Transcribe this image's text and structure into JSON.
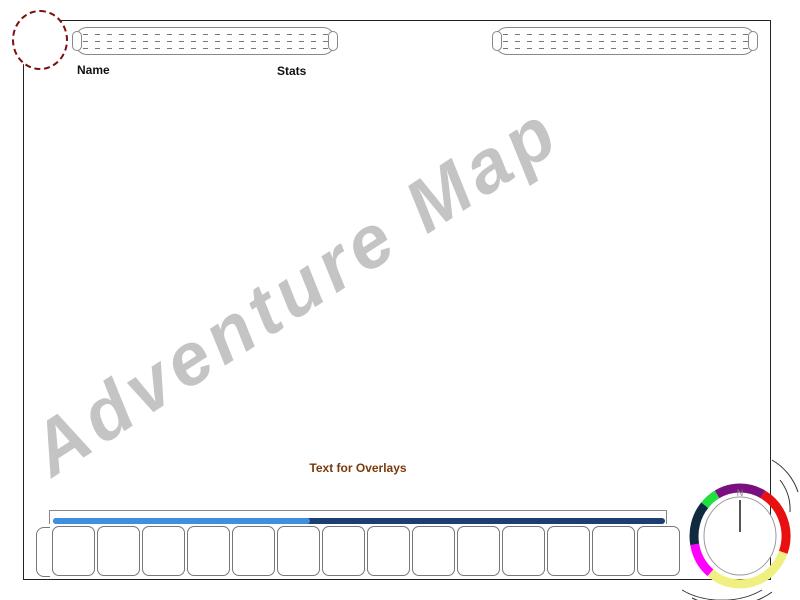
{
  "player": {
    "name_label": "Name",
    "stats_label": "Stats"
  },
  "map": {
    "watermark_text": "Adventure Map"
  },
  "overlay": {
    "text": "Text for Overlays"
  },
  "hotbar": {
    "slot_count": 14,
    "xp_progress": 0.42
  },
  "compass": {
    "north_label": "N",
    "ring_colors": [
      "#7a1080",
      "#e81010",
      "#f0f080",
      "#ff00ff",
      "#102a40",
      "#20e040"
    ]
  },
  "colors": {
    "portrait_border": "#7a1010",
    "overlay_text": "#7a3a0a",
    "xp_fill": "#3f8fe0",
    "xp_track": "#1c3f73",
    "watermark": "#c4c4c4"
  }
}
